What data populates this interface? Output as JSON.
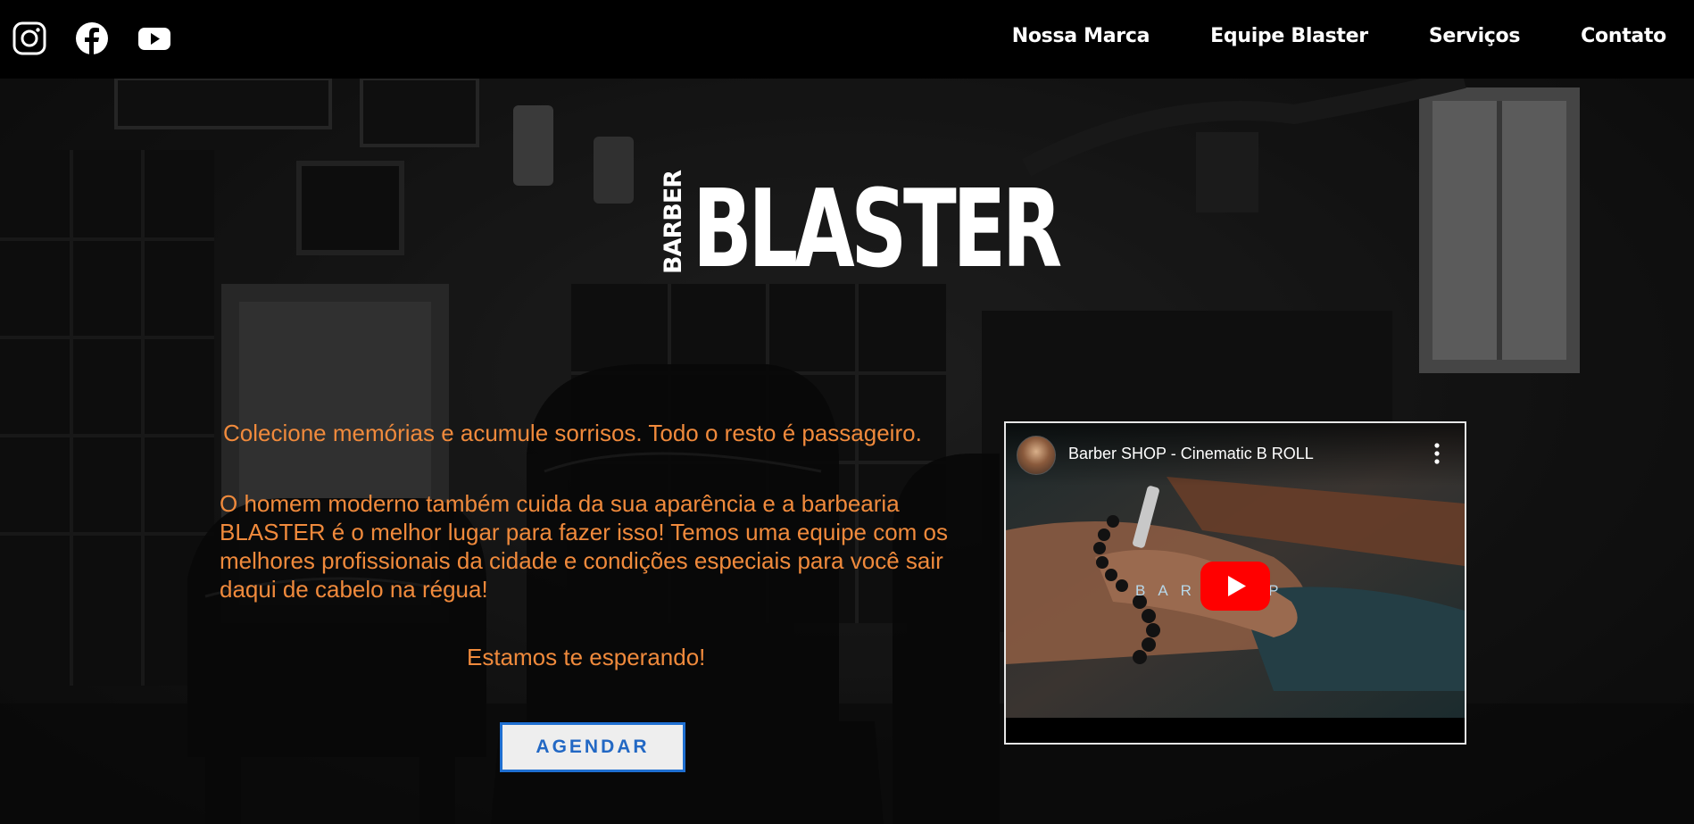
{
  "header": {
    "social_icons": [
      "instagram-icon",
      "facebook-icon",
      "youtube-icon"
    ],
    "nav": [
      {
        "label": "Nossa Marca"
      },
      {
        "label": "Equipe Blaster"
      },
      {
        "label": "Serviços"
      },
      {
        "label": "Contato"
      }
    ]
  },
  "logo": {
    "small_word": "BARBER",
    "big_word": "BLASTER"
  },
  "hero": {
    "tagline": "Colecione memórias e acumule sorrisos. Todo o resto é passageiro.",
    "description": "O homem moderno também cuida da sua aparência e a barbearia BLASTER é o melhor lugar para fazer isso! Temos uma equipe com os melhores profissionais da cidade e condições especiais para você sair daqui de cabelo na régua!",
    "waiting": "Estamos te esperando!",
    "cta_label": "AGENDAR"
  },
  "video": {
    "title": "Barber SHOP - Cinematic B ROLL",
    "overlay_text": "BAR      HOP",
    "play_icon": "youtube-play-icon",
    "menu_icon": "more-vert-icon"
  },
  "colors": {
    "accent_text": "#f08a3c",
    "button_border": "#1f6fd1",
    "topbar_bg": "#000000",
    "youtube_red": "#ff0000"
  }
}
